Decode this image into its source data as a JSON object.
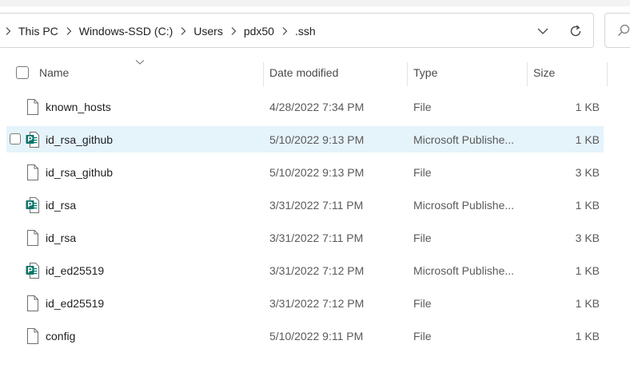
{
  "breadcrumb": [
    "This PC",
    "Windows-SSD (C:)",
    "Users",
    "pdx50",
    ".ssh"
  ],
  "columns": {
    "name": "Name",
    "date_modified": "Date modified",
    "type": "Type",
    "size": "Size"
  },
  "files": [
    {
      "name": "known_hosts",
      "date": "4/28/2022 7:34 PM",
      "type": "File",
      "size": "1 KB",
      "icon": "file-icon",
      "selected": false
    },
    {
      "name": "id_rsa_github",
      "date": "5/10/2022 9:13 PM",
      "type": "Microsoft Publishe...",
      "size": "1 KB",
      "icon": "publisher-file-icon",
      "selected": true
    },
    {
      "name": "id_rsa_github",
      "date": "5/10/2022 9:13 PM",
      "type": "File",
      "size": "3 KB",
      "icon": "file-icon",
      "selected": false
    },
    {
      "name": "id_rsa",
      "date": "3/31/2022 7:11 PM",
      "type": "Microsoft Publishe...",
      "size": "1 KB",
      "icon": "publisher-file-icon",
      "selected": false
    },
    {
      "name": "id_rsa",
      "date": "3/31/2022 7:11 PM",
      "type": "File",
      "size": "3 KB",
      "icon": "file-icon",
      "selected": false
    },
    {
      "name": "id_ed25519",
      "date": "3/31/2022 7:12 PM",
      "type": "Microsoft Publishe...",
      "size": "1 KB",
      "icon": "publisher-file-icon",
      "selected": false
    },
    {
      "name": "id_ed25519",
      "date": "3/31/2022 7:12 PM",
      "type": "File",
      "size": "1 KB",
      "icon": "file-icon",
      "selected": false
    },
    {
      "name": "config",
      "date": "5/10/2022 9:11 PM",
      "type": "File",
      "size": "1 KB",
      "icon": "file-icon",
      "selected": false
    }
  ],
  "colors": {
    "selection": "#e5f3fb",
    "publisher_icon": "#077568"
  }
}
